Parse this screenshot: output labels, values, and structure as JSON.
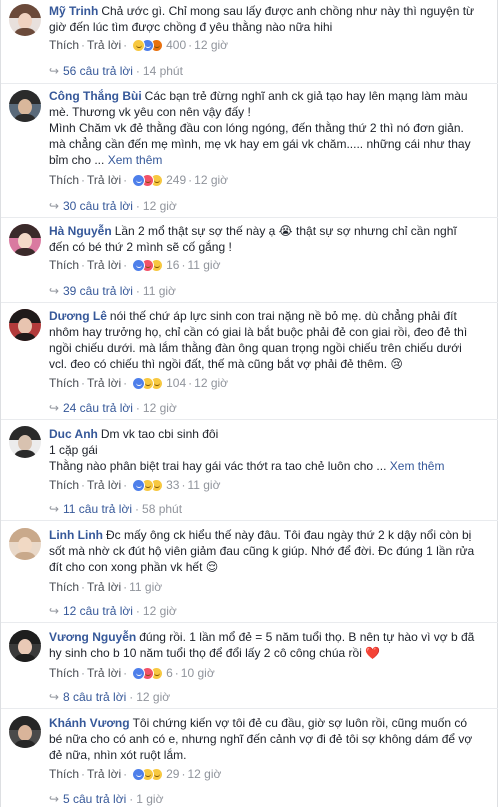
{
  "comments": [
    {
      "name": "Mỹ Trinh",
      "text": "Chả ước gì. Chỉ mong sau lấy được anh chồng như này thì nguyện từ giờ đến lúc tìm được chồng đ yêu thằng nào nữa hihi",
      "more": "",
      "like": "Thích",
      "reply": "Trả lời",
      "reactions": "400",
      "time": "12 giờ",
      "replies_label": "56 câu trả lời",
      "replies_time": "14 phút",
      "reaction_icons": [
        "haha",
        "like",
        "angry"
      ],
      "avatar_colors": [
        "#6b4a3a",
        "#f0d2c0",
        "#e8e0dc"
      ]
    },
    {
      "name": "Công Thắng Bùi",
      "text": "Các bạn trẻ đừng nghĩ anh ck giả tạo hay lên mạng làm màu mè. Thương vk yêu con nên vậy đấy !\nMình Chăm vk đẻ thằng đầu con lóng ngóng, đến thằng thứ 2 thì nó đơn giản. mà chẳng cần đến mẹ mình, mẹ vk hay em gái vk chăm..... những cái như thay bỉm cho ...",
      "more": "Xem thêm",
      "like": "Thích",
      "reply": "Trả lời",
      "reactions": "249",
      "time": "12 giờ",
      "replies_label": "30 câu trả lời",
      "replies_time": "12 giờ",
      "reaction_icons": [
        "like",
        "love",
        "sad"
      ],
      "avatar_colors": [
        "#2b2b2b",
        "#d9b79b",
        "#5a6a7a"
      ]
    },
    {
      "name": "Hà Nguyễn",
      "text": "Lần 2 mổ thật sự sợ thế này ạ 😭 thật sự sợ nhưng chỉ cần nghĩ đến có bé thứ 2 mình sẽ cố gắng !",
      "more": "",
      "like": "Thích",
      "reply": "Trả lời",
      "reactions": "16",
      "time": "11 giờ",
      "replies_label": "39 câu trả lời",
      "replies_time": "11 giờ",
      "reaction_icons": [
        "like",
        "love",
        "sad"
      ],
      "avatar_colors": [
        "#3a2a2a",
        "#f3d9c8",
        "#d97aa0"
      ]
    },
    {
      "name": "Dương Lê",
      "text": "nói thế chứ áp lực sinh con trai nặng nề bỏ mẹ. dù chẳng phải đít nhôm hay trưởng họ, chỉ cần có giai là bắt buộc phải đẻ con giai rồi, đeo đẻ thì ngồi chiếu dưới. mà lắm thằng đàn ông quan trọng ngồi chiếu trên chiếu dưới vcl. đeo có chiếu thì ngồi đất, thế mà cũng bắt vợ phải đẻ thêm. 😢",
      "more": "",
      "like": "Thích",
      "reply": "Trả lời",
      "reactions": "104",
      "time": "12 giờ",
      "replies_label": "24 câu trả lời",
      "replies_time": "12 giờ",
      "reaction_icons": [
        "like",
        "haha",
        "sad"
      ],
      "avatar_colors": [
        "#1f1a1a",
        "#e8c4b0",
        "#b23b3b"
      ]
    },
    {
      "name": "Duc Anh",
      "text": "Dm vk tao cbi sinh đôi\n1 cặp gái\nThằng nào phân biệt trai hay gái vác thớt ra tao chẻ luôn cho ...",
      "more": "Xem thêm",
      "like": "Thích",
      "reply": "Trả lời",
      "reactions": "33",
      "time": "11 giờ",
      "replies_label": "11 câu trả lời",
      "replies_time": "58 phút",
      "reaction_icons": [
        "like",
        "haha",
        "sad"
      ],
      "avatar_colors": [
        "#2a2a2a",
        "#d8c2b0",
        "#ececec"
      ]
    },
    {
      "name": "Linh Linh",
      "text": "Đc mấy ông ck hiểu thế này đâu. Tôi đau ngày thứ 2 k dậy nổi còn bị sốt mà nhờ ck đút hộ viên giảm đau cũng k giúp. Nhớ để đời. Đc đúng 1 lần rửa đít cho con xong phần vk hết 😌",
      "more": "",
      "like": "Thích",
      "reply": "Trả lời",
      "reactions": "",
      "time": "11 giờ",
      "replies_label": "12 câu trả lời",
      "replies_time": "12 giờ",
      "reaction_icons": [],
      "avatar_colors": [
        "#c9a98b",
        "#f1d9c4",
        "#e9d8c8"
      ]
    },
    {
      "name": "Vương Nguyễn",
      "text": "đúng rồi. 1 lần mổ đẻ = 5 năm tuổi thọ. B nên tự hào vì vợ b đã hy sinh cho b 10 năm tuổi thọ để đổi lấy 2 cô công chúa rồi ❤️",
      "more": "",
      "like": "Thích",
      "reply": "Trả lời",
      "reactions": "6",
      "time": "10 giờ",
      "replies_label": "8 câu trả lời",
      "replies_time": "12 giờ",
      "reaction_icons": [
        "like",
        "love",
        "sad"
      ],
      "avatar_colors": [
        "#1e1e1e",
        "#e9c9b6",
        "#3a3a3a"
      ]
    },
    {
      "name": "Khánh Vương",
      "text": "Tôi chứng kiến vợ tôi đẻ cu đầu, giờ sợ luôn rồi, cũng muốn có bé nữa cho có anh có e, nhưng nghĩ đến cảnh vợ đi đẻ tôi sợ không dám để vợ đẻ nữa, nhìn xót ruột lắm.",
      "more": "",
      "like": "Thích",
      "reply": "Trả lời",
      "reactions": "29",
      "time": "12 giờ",
      "replies_label": "5 câu trả lời",
      "replies_time": "1 giờ",
      "reaction_icons": [
        "like",
        "wow",
        "sad"
      ],
      "avatar_colors": [
        "#262626",
        "#d9b49a",
        "#4a4a4a"
      ]
    }
  ]
}
